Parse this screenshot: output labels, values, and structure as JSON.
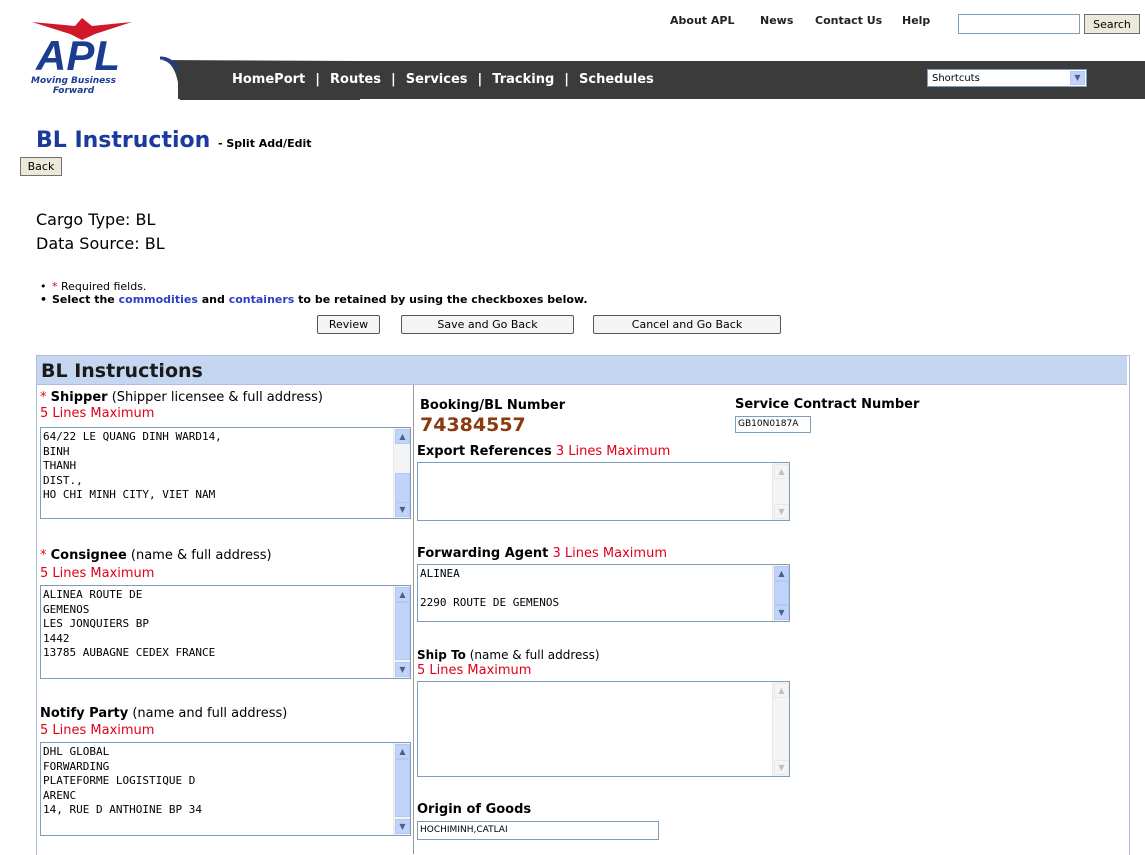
{
  "header": {
    "logo_text": "APL",
    "tagline_line1": "Moving Business",
    "tagline_line2": "Forward",
    "top_links": [
      "About APL",
      "News",
      "Contact Us",
      "Help"
    ],
    "search_button": "Search",
    "nav": [
      "HomePort",
      "Routes",
      "Services",
      "Tracking",
      "Schedules"
    ],
    "nav_separator": "|",
    "shortcuts": "Shortcuts"
  },
  "page": {
    "title": "BL Instruction",
    "subtitle": "- Split Add/Edit",
    "back_button": "Back",
    "cargo_type": "Cargo Type: BL",
    "data_source": "Data Source: BL",
    "required_star": "*",
    "required_text": "Required fields.",
    "instruction_prefix": "Select the",
    "instruction_commodities": "commodities",
    "instruction_and": "and",
    "instruction_containers": "containers",
    "instruction_suffix": "to be retained by using the checkboxes below.",
    "buttons": {
      "review": "Review",
      "save_back": "Save and Go Back",
      "cancel_back": "Cancel and Go Back"
    }
  },
  "form": {
    "heading": "BL Instructions",
    "shipper": {
      "label": "Shipper",
      "hint": "(Shipper licensee & full address)",
      "max": "5 Lines Maximum",
      "value": "64/22 LE QUANG DINH WARD14,\nBINH\nTHANH\nDIST.,\nHO CHI MINH CITY, VIET NAM"
    },
    "consignee": {
      "label": "Consignee",
      "hint": "(name & full address)",
      "max": "5 Lines Maximum",
      "value": "ALINEA ROUTE DE\nGEMENOS\nLES JONQUIERS BP\n1442\n13785 AUBAGNE CEDEX FRANCE"
    },
    "notify": {
      "label": "Notify Party",
      "hint": "(name and full address)",
      "max": "5 Lines Maximum",
      "value": "DHL GLOBAL\nFORWARDING\nPLATEFORME LOGISTIQUE D\nARENC\n14, RUE D ANTHOINE BP 34"
    },
    "booking": {
      "label": "Booking/BL Number",
      "value": "74384557"
    },
    "service_contract": {
      "label": "Service Contract Number",
      "value": "GB10N0187A"
    },
    "export_refs": {
      "label": "Export References",
      "max": "3 Lines Maximum",
      "value": ""
    },
    "forwarding_agent": {
      "label": "Forwarding Agent",
      "max": "3 Lines Maximum",
      "value": "ALINEA\n\n2290 ROUTE DE GEMENOS"
    },
    "ship_to": {
      "label": "Ship To",
      "hint": "(name & full address)",
      "max": "5 Lines Maximum",
      "value": ""
    },
    "origin": {
      "label": "Origin of Goods",
      "value": "HOCHIMINH,CATLAI"
    }
  }
}
